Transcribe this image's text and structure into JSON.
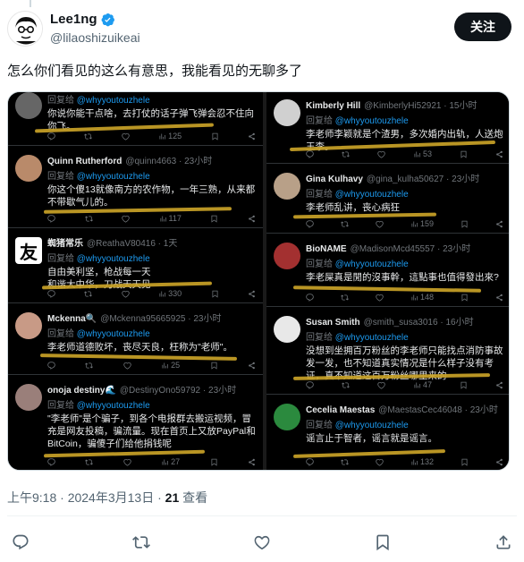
{
  "author": {
    "name": "Lee1ng",
    "handle": "@lilaoshizuikeai"
  },
  "follow_label": "关注",
  "tweet_text": "怎么你们看见的这么有意思，我能看见的无聊多了",
  "reply_to_label": "回复给",
  "reply_to_mention": "@whyyoutouzhele",
  "replies_left": [
    {
      "name": "",
      "handle": "",
      "time": "",
      "text": "你说你能干点啥，去打仗的话子弹飞弹会忍不住向你飞。",
      "views": "125",
      "avatar_color": "#666666"
    },
    {
      "name": "Quinn Rutherford",
      "handle": "@quinn4663",
      "time": "· 23小时",
      "text": "你这个傻13就像南方的农作物，一年三熟，从来都不带歇气儿的。",
      "views": "117",
      "avatar_color": "#b98a6a"
    },
    {
      "name": "蜘猪常乐",
      "handle": "@ReathaV80416",
      "time": "· 1天",
      "text": "自由美利坚，枪战每一天\n和谐大中华，刀战天天见",
      "views": "330",
      "avatar_color": "#ffffff"
    },
    {
      "name": "Mckenna🔍",
      "handle": "@Mckenna95665925",
      "time": "· 23小时",
      "text": "李老师道德败坏，丧尽天良，枉称为\"老师\"。",
      "views": "25",
      "avatar_color": "#c89a86"
    },
    {
      "name": "onoja destiny🌊",
      "handle": "@DestinyOno59792",
      "time": "· 23小时",
      "text": "\"李老师\"是个骗子，到各个电报群去搬运视频，冒充是网友投稿，骗流量。现在首页上又放PayPal和BitCoin，骗傻子们给他捐钱呢",
      "views": "27",
      "avatar_color": "#9a7f7a"
    }
  ],
  "replies_right": [
    {
      "name": "Kimberly Hill",
      "handle": "@KimberlyHi52921",
      "time": "· 15小时",
      "text": "李老师李颖就是个渣男，多次婚内出轨，人送炮王李。",
      "views": "53",
      "avatar_color": "#d0d0d0"
    },
    {
      "name": "Gina Kulhavy",
      "handle": "@gina_kulha50627",
      "time": "· 23小时",
      "text": "李老师乱讲，丧心病狂",
      "views": "159",
      "avatar_color": "#b8a088"
    },
    {
      "name": "BioNAME",
      "handle": "@MadisonMcd45557",
      "time": "· 23小时",
      "text": "李老屎真是閒的沒事幹，這點事也值得發出來?",
      "views": "148",
      "avatar_color": "#a33030"
    },
    {
      "name": "Susan Smith",
      "handle": "@smith_susa3016",
      "time": "· 16小时",
      "text": "没想到坐拥百万粉丝的李老师只能找点消防事故发一发，也不知道真实情况是什么样子没有考证，真不知道这百万粉丝哪里来的",
      "views": "47",
      "avatar_color": "#e8e8e8"
    },
    {
      "name": "Cecelia Maestas",
      "handle": "@MaestasCec46048",
      "time": "· 23小时",
      "text": "谣言止于智者，谣言就是谣言。",
      "views": "132",
      "avatar_color": "#2b8a3e"
    }
  ],
  "meta": {
    "time": "上午9:18",
    "date": "2024年3月13日",
    "views_count": "21",
    "views_label": "查看"
  }
}
